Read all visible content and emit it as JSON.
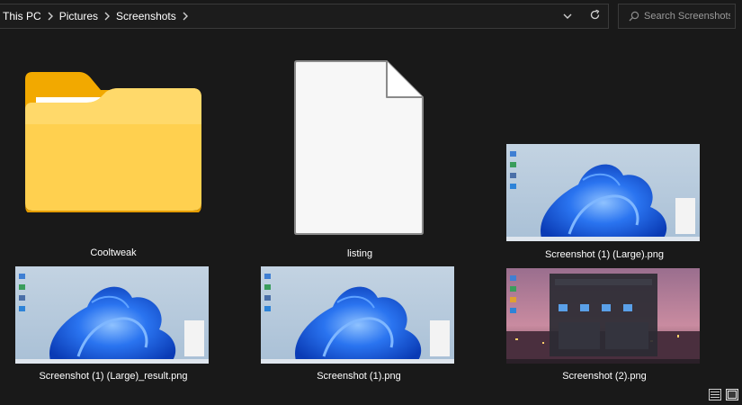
{
  "breadcrumb": {
    "items": [
      {
        "label": "This PC"
      },
      {
        "label": "Pictures"
      },
      {
        "label": "Screenshots"
      }
    ]
  },
  "search": {
    "placeholder": "Search Screenshots"
  },
  "icons": {
    "back_dropdown": "chevron-down-icon",
    "refresh": "refresh-icon",
    "search": "search-icon",
    "details_view": "details-view-icon",
    "large_icons_view": "large-icons-view-icon"
  },
  "colors": {
    "background": "#191919",
    "folder_front": "#FFD75E",
    "folder_back": "#FFB900",
    "win11_bloom": "#1B5FE0",
    "wallpaper_sky": "#B9CCDC"
  },
  "files": [
    {
      "name": "Cooltweak",
      "kind": "folder"
    },
    {
      "name": "listing",
      "kind": "file"
    },
    {
      "name": "Screenshot (1) (Large).png",
      "kind": "image"
    },
    {
      "name": "Screenshot (1) (Large)_result.png",
      "kind": "image"
    },
    {
      "name": "Screenshot (1).png",
      "kind": "image"
    },
    {
      "name": "Screenshot (2).png",
      "kind": "image"
    }
  ]
}
